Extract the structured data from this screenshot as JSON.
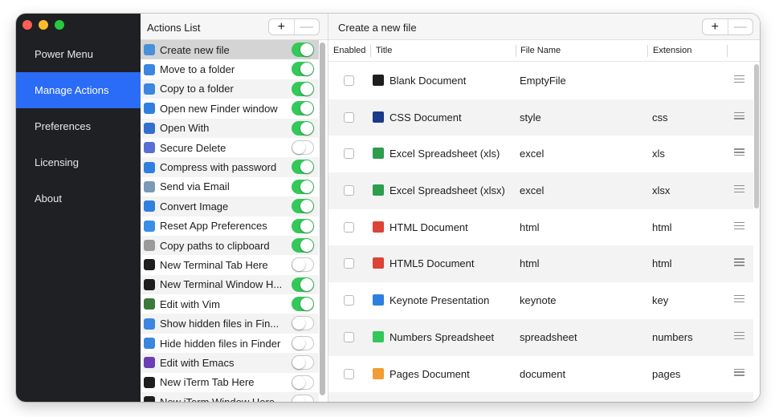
{
  "sidebar": {
    "items": [
      {
        "label": "Power Menu",
        "active": false
      },
      {
        "label": "Manage Actions",
        "active": true
      },
      {
        "label": "Preferences",
        "active": false
      },
      {
        "label": "Licensing",
        "active": false
      },
      {
        "label": "About",
        "active": false
      }
    ]
  },
  "actions_panel": {
    "title": "Actions List",
    "add_label": "+",
    "remove_label": "—",
    "items": [
      {
        "label": "Create new file",
        "enabled": true,
        "icon": "new-file-icon",
        "icon_color": "#4a90d9",
        "selected": true
      },
      {
        "label": "Move to a folder",
        "enabled": true,
        "icon": "move-folder-icon",
        "icon_color": "#3a86e0"
      },
      {
        "label": "Copy to a folder",
        "enabled": true,
        "icon": "copy-folder-icon",
        "icon_color": "#3a86e0"
      },
      {
        "label": "Open new Finder window",
        "enabled": true,
        "icon": "finder-window-icon",
        "icon_color": "#2f7fe0"
      },
      {
        "label": "Open With",
        "enabled": true,
        "icon": "open-with-icon",
        "icon_color": "#2f6fd0"
      },
      {
        "label": "Secure Delete",
        "enabled": false,
        "icon": "trash-icon",
        "icon_color": "#5a6fd6"
      },
      {
        "label": "Compress with password",
        "enabled": true,
        "icon": "zip-icon",
        "icon_color": "#2f7fe0"
      },
      {
        "label": "Send via Email",
        "enabled": true,
        "icon": "email-icon",
        "icon_color": "#7a9ab8"
      },
      {
        "label": "Convert Image",
        "enabled": true,
        "icon": "image-convert-icon",
        "icon_color": "#2f7fe0"
      },
      {
        "label": "Reset App Preferences",
        "enabled": true,
        "icon": "reset-icon",
        "icon_color": "#3a8ee8"
      },
      {
        "label": "Copy paths to clipboard",
        "enabled": true,
        "icon": "clipboard-icon",
        "icon_color": "#9a9a9a"
      },
      {
        "label": "New Terminal Tab Here",
        "enabled": false,
        "icon": "terminal-icon",
        "icon_color": "#1e1e1e"
      },
      {
        "label": "New Terminal Window H...",
        "enabled": true,
        "icon": "terminal-icon",
        "icon_color": "#1e1e1e"
      },
      {
        "label": "Edit with Vim",
        "enabled": true,
        "icon": "vim-icon",
        "icon_color": "#3c7a3c"
      },
      {
        "label": "Show hidden files in Fin...",
        "enabled": false,
        "icon": "eye-icon",
        "icon_color": "#3a86e0"
      },
      {
        "label": "Hide hidden files in Finder",
        "enabled": false,
        "icon": "eye-slash-icon",
        "icon_color": "#3a86e0"
      },
      {
        "label": "Edit with Emacs",
        "enabled": false,
        "icon": "emacs-icon",
        "icon_color": "#6a3fb5"
      },
      {
        "label": "New iTerm Tab Here",
        "enabled": false,
        "icon": "iterm-icon",
        "icon_color": "#1e1e1e"
      },
      {
        "label": "New iTerm Window Here",
        "enabled": false,
        "icon": "iterm-icon",
        "icon_color": "#1e1e1e"
      }
    ]
  },
  "file_panel": {
    "title": "Create a new file",
    "add_label": "+",
    "remove_label": "—",
    "columns": {
      "enabled": "Enabled",
      "title": "Title",
      "file_name": "File Name",
      "extension": "Extension"
    },
    "rows": [
      {
        "title": "Blank Document",
        "file_name": "EmptyFile",
        "extension": "",
        "icon": "blank-doc-icon",
        "icon_color": "#1e1e1e"
      },
      {
        "title": "CSS Document",
        "file_name": "style",
        "extension": "css",
        "icon": "css-doc-icon",
        "icon_color": "#1a3a8a"
      },
      {
        "title": "Excel Spreadsheet (xls)",
        "file_name": "excel",
        "extension": "xls",
        "icon": "excel-icon",
        "icon_color": "#2e9e4d"
      },
      {
        "title": "Excel Spreadsheet (xlsx)",
        "file_name": "excel",
        "extension": "xlsx",
        "icon": "excel-icon",
        "icon_color": "#2e9e4d"
      },
      {
        "title": "HTML Document",
        "file_name": "html",
        "extension": "html",
        "icon": "chrome-icon",
        "icon_color": "#db4437"
      },
      {
        "title": "HTML5 Document",
        "file_name": "html",
        "extension": "html",
        "icon": "chrome-icon",
        "icon_color": "#db4437"
      },
      {
        "title": "Keynote Presentation",
        "file_name": "keynote",
        "extension": "key",
        "icon": "keynote-icon",
        "icon_color": "#2f7fe0"
      },
      {
        "title": "Numbers Spreadsheet",
        "file_name": "spreadsheet",
        "extension": "numbers",
        "icon": "numbers-icon",
        "icon_color": "#34c759"
      },
      {
        "title": "Pages Document",
        "file_name": "document",
        "extension": "pages",
        "icon": "pages-icon",
        "icon_color": "#f39c34"
      },
      {
        "title": "",
        "file_name": "",
        "extension": "",
        "icon": "doc-icon",
        "icon_color": "#c8c8c8"
      }
    ]
  },
  "colors": {
    "accent": "#2b6cf6",
    "toggle_on": "#34c759",
    "sidebar_bg": "#1f2023"
  }
}
